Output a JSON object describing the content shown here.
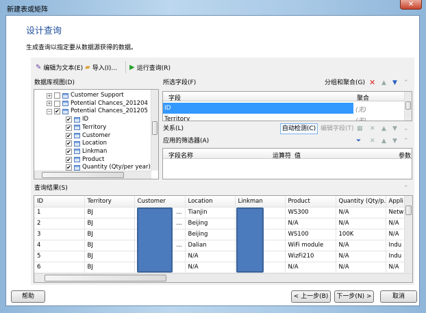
{
  "window": {
    "title": "新建表或矩阵",
    "close": "✕"
  },
  "header": {
    "title": "设计查询",
    "subtitle": "生成查询以指定要从数据源获得的数据。"
  },
  "toolbar": {
    "edit_as_text": "编辑为文本(E)",
    "import": "导入(I)...",
    "run_query": "运行查询(R)"
  },
  "db_view": {
    "label": "数据库视图(D)",
    "items": [
      {
        "label": "Customer Support",
        "level": 0,
        "checked": false,
        "expander": "+"
      },
      {
        "label": "Potential Chances_201204",
        "level": 0,
        "checked": false,
        "expander": "+"
      },
      {
        "label": "Potential Chances_201205",
        "level": 0,
        "checked": true,
        "expander": "-"
      },
      {
        "label": "ID",
        "level": 1,
        "checked": true
      },
      {
        "label": "Territory",
        "level": 1,
        "checked": true
      },
      {
        "label": "Customer",
        "level": 1,
        "checked": true
      },
      {
        "label": "Location",
        "level": 1,
        "checked": true
      },
      {
        "label": "Linkman",
        "level": 1,
        "checked": true
      },
      {
        "label": "Product",
        "level": 1,
        "checked": true
      },
      {
        "label": "Quantity (Qty/per year)",
        "level": 1,
        "checked": true
      }
    ]
  },
  "selected_fields": {
    "label": "所选字段(F)",
    "group_agg": "分组和聚合(G)",
    "col_field": "字段",
    "col_agg": "聚合",
    "rows": [
      {
        "field": "ID",
        "agg": "(无)",
        "selected": true
      },
      {
        "field": "Territory",
        "agg": "(无)",
        "selected": false
      }
    ]
  },
  "relations": {
    "label": "关系(L)",
    "auto_detect": "自动检测(C)",
    "edit_fields": "编辑字段(T)"
  },
  "filters": {
    "label": "应用的筛选器(A)",
    "columns": [
      "字段名称",
      "运算符",
      "值",
      "参数"
    ]
  },
  "results": {
    "label": "查询结果(S)",
    "columns": [
      "ID",
      "Territory",
      "Customer",
      "Location",
      "Linkman",
      "Product",
      "Quantity (Qty/p...",
      "Appli"
    ],
    "rows": [
      [
        "1",
        "BJ",
        "...",
        "Tianjin",
        "",
        "WS300",
        "N/A",
        "Netw"
      ],
      [
        "2",
        "BJ",
        "...",
        "Beijing",
        "",
        "N/A",
        "N/A",
        "N/A"
      ],
      [
        "3",
        "BJ",
        "",
        "Beijing",
        "",
        "WS100",
        "100K",
        "N/A"
      ],
      [
        "4",
        "BJ",
        "...",
        "Dalian",
        "",
        "WiFi module",
        "N/A",
        "Indu"
      ],
      [
        "5",
        "BJ",
        "",
        "N/A",
        "",
        "WizFi210",
        "N/A",
        "Indu"
      ],
      [
        "6",
        "BJ",
        "",
        "N/A",
        "",
        "N/A",
        "N/A",
        "N/A"
      ]
    ]
  },
  "buttons": {
    "help": "帮助",
    "back": "< 上一步(B)",
    "next": "下一步(N) >",
    "cancel": "取消"
  },
  "colors": {
    "accent": "#3399ff",
    "title_blue": "#1e4f9a",
    "redaction": "#4b7bbd"
  }
}
